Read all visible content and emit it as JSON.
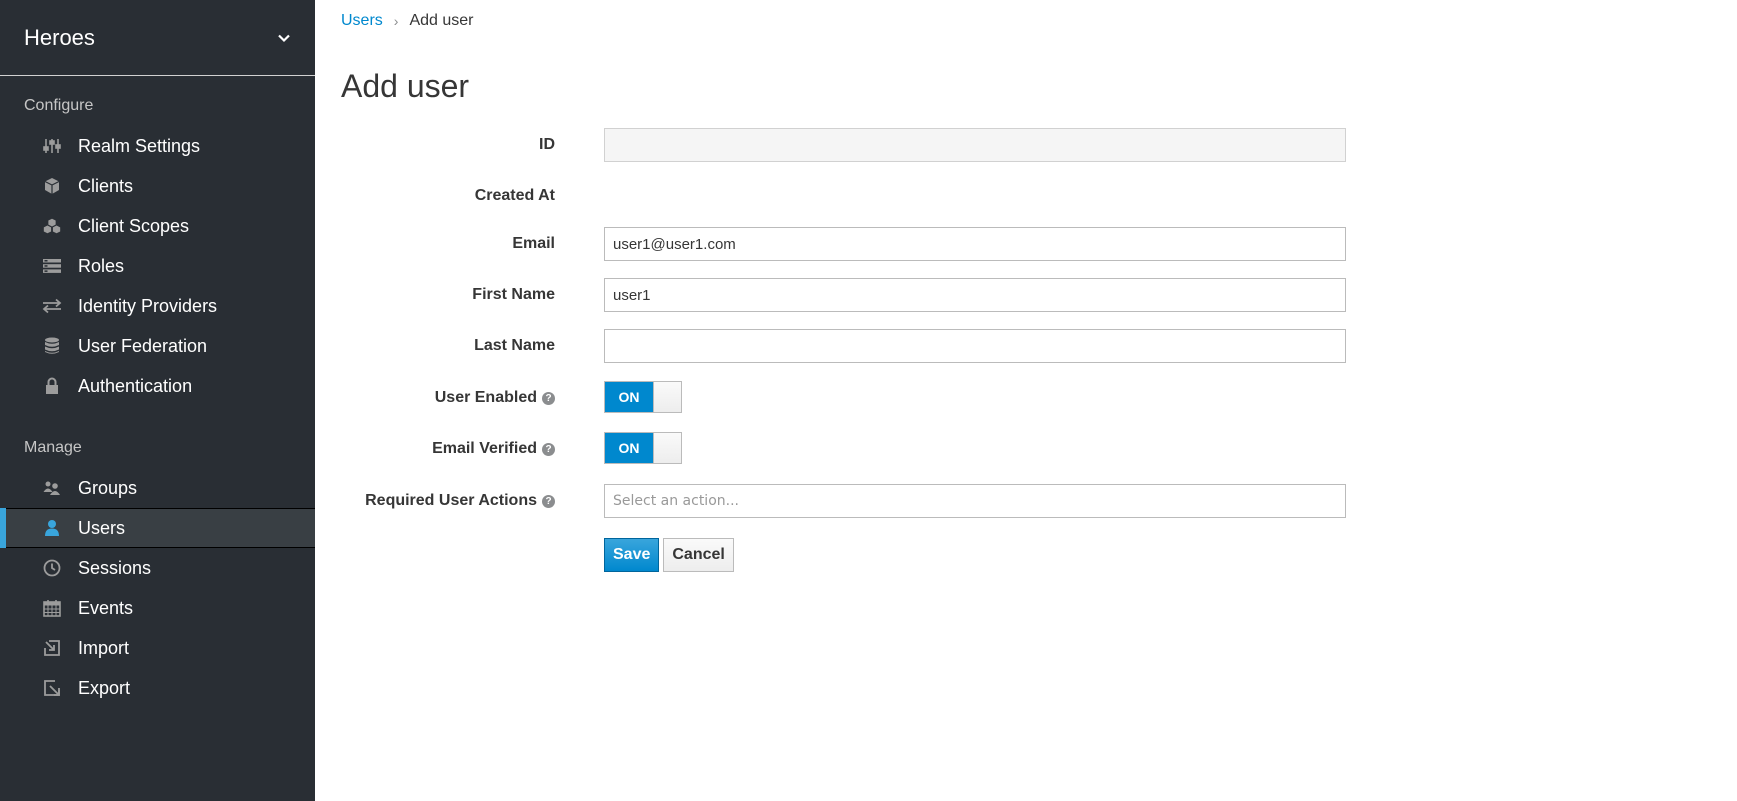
{
  "sidebar": {
    "realm_name": "Heroes",
    "configure_title": "Configure",
    "manage_title": "Manage",
    "configure_items": [
      {
        "label": "Realm Settings",
        "icon": "sliders-icon"
      },
      {
        "label": "Clients",
        "icon": "cube-icon"
      },
      {
        "label": "Client Scopes",
        "icon": "cubes-icon"
      },
      {
        "label": "Roles",
        "icon": "roles-list-icon"
      },
      {
        "label": "Identity Providers",
        "icon": "exchange-icon"
      },
      {
        "label": "User Federation",
        "icon": "database-icon"
      },
      {
        "label": "Authentication",
        "icon": "lock-icon"
      }
    ],
    "manage_items": [
      {
        "label": "Groups",
        "icon": "users-icon"
      },
      {
        "label": "Users",
        "icon": "user-icon",
        "active": true
      },
      {
        "label": "Sessions",
        "icon": "clock-icon"
      },
      {
        "label": "Events",
        "icon": "calendar-icon"
      },
      {
        "label": "Import",
        "icon": "import-icon"
      },
      {
        "label": "Export",
        "icon": "export-icon"
      }
    ]
  },
  "breadcrumb": {
    "parent": "Users",
    "separator": "›",
    "current": "Add user"
  },
  "page_title": "Add user",
  "form": {
    "id": {
      "label": "ID",
      "value": ""
    },
    "created_at": {
      "label": "Created At",
      "value": ""
    },
    "email": {
      "label": "Email",
      "value": "user1@user1.com"
    },
    "first_name": {
      "label": "First Name",
      "value": "user1"
    },
    "last_name": {
      "label": "Last Name",
      "value": ""
    },
    "user_enabled": {
      "label": "User Enabled",
      "state": "ON"
    },
    "email_verified": {
      "label": "Email Verified",
      "state": "ON"
    },
    "required_actions": {
      "label": "Required User Actions",
      "placeholder": "Select an action..."
    },
    "save_label": "Save",
    "cancel_label": "Cancel"
  },
  "colors": {
    "sidebar_bg": "#292e34",
    "accent": "#0088ce",
    "active_marker": "#39a5dc"
  }
}
